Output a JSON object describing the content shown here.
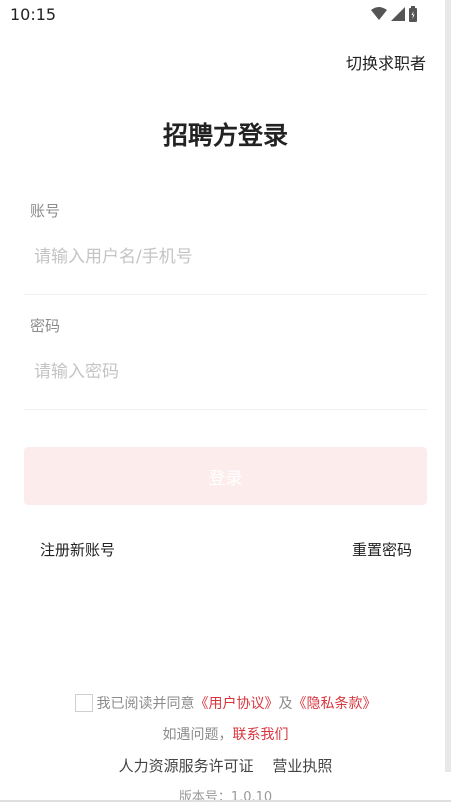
{
  "status_bar": {
    "time": "10:15",
    "icons": [
      "wifi-icon",
      "signal-icon",
      "battery-icon"
    ]
  },
  "header": {
    "switch_role": "切换求职者"
  },
  "page": {
    "title": "招聘方登录"
  },
  "form": {
    "account_label": "账号",
    "account_placeholder": "请输入用户名/手机号",
    "account_value": "",
    "password_label": "密码",
    "password_placeholder": "请输入密码",
    "password_value": "",
    "login_button": "登录"
  },
  "links": {
    "register": "注册新账号",
    "reset_password": "重置密码"
  },
  "agreement": {
    "checked": false,
    "prefix": "我已阅读并同意",
    "user_agreement": "《用户协议》",
    "and": "及",
    "privacy_policy": "《隐私条款》"
  },
  "help": {
    "prefix": "如遇问题，",
    "contact": "联系我们"
  },
  "footer": {
    "hr_license": "人力资源服务许可证",
    "business_license": "营业执照",
    "version": "版本号：1.0.10"
  },
  "colors": {
    "accent": "#d9363e",
    "button_disabled_bg": "#fdecec",
    "muted_text": "#8c8c8c"
  }
}
